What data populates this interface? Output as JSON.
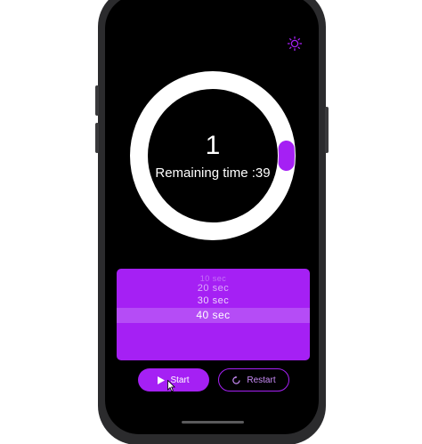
{
  "timer": {
    "count": "1",
    "remaining_label": "Remaining time :39",
    "progress_fraction": 0.03
  },
  "picker": {
    "options": [
      "10 sec",
      "20 sec",
      "30 sec",
      "40 sec"
    ],
    "selected": "40 sec"
  },
  "controls": {
    "start_label": "Start",
    "restart_label": "Restart"
  },
  "icons": {
    "settings": "settings-icon",
    "play": "play-icon",
    "restart": "restart-icon"
  },
  "colors": {
    "accent": "#a520f4",
    "ring": "#ffffff",
    "background": "#000000"
  }
}
